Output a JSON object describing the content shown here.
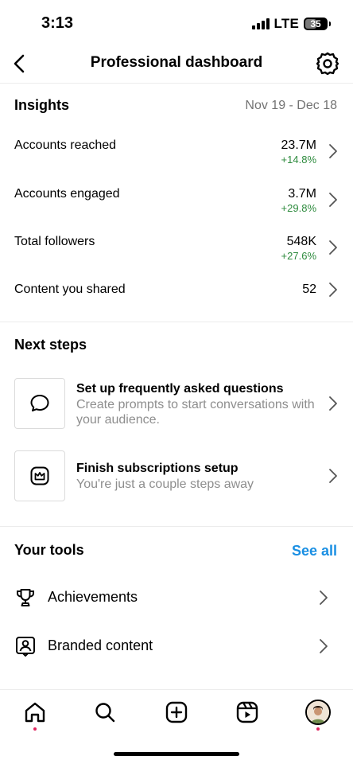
{
  "status_bar": {
    "time": "3:13",
    "network": "LTE",
    "battery": "35"
  },
  "header": {
    "title": "Professional dashboard"
  },
  "insights": {
    "title": "Insights",
    "date_range": "Nov 19 - Dec 18",
    "rows": [
      {
        "label": "Accounts reached",
        "value": "23.7M",
        "change": "+14.8%"
      },
      {
        "label": "Accounts engaged",
        "value": "3.7M",
        "change": "+29.8%"
      },
      {
        "label": "Total followers",
        "value": "548K",
        "change": "+27.6%"
      },
      {
        "label": "Content you shared",
        "value": "52",
        "change": ""
      }
    ]
  },
  "next_steps": {
    "title": "Next steps",
    "items": [
      {
        "title": "Set up frequently asked questions",
        "subtitle": "Create prompts to start conversations with your audience.",
        "icon": "chat-bubble-icon"
      },
      {
        "title": "Finish subscriptions setup",
        "subtitle": "You're just a couple steps away",
        "icon": "subscriptions-crown-icon"
      }
    ]
  },
  "tools": {
    "title": "Your tools",
    "see_all": "See all",
    "items": [
      {
        "label": "Achievements",
        "icon": "trophy-icon"
      },
      {
        "label": "Branded content",
        "icon": "branded-content-icon"
      }
    ]
  },
  "tab_bar": {
    "items": [
      "home-icon",
      "search-icon",
      "create-icon",
      "reels-icon",
      "profile-avatar"
    ],
    "notification_dot_color": "#e0245e"
  },
  "colors": {
    "accent": "#1a8fe3",
    "positive": "#2e8b3e",
    "muted": "#737373"
  }
}
